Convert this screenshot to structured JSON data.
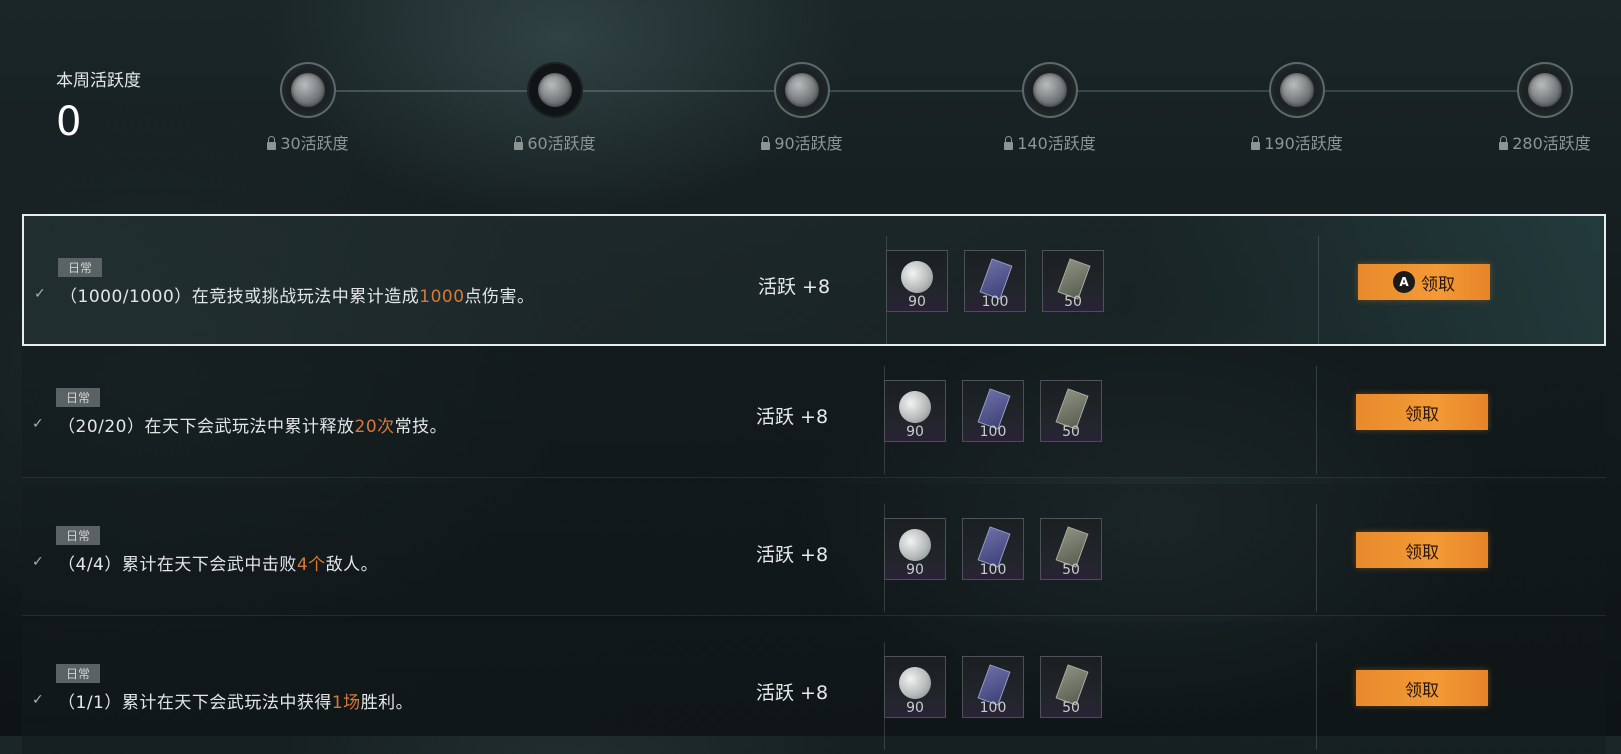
{
  "weekly": {
    "title": "本周活跃度",
    "value": "0"
  },
  "milestones": [
    {
      "label": "30活跃度"
    },
    {
      "label": "60活跃度"
    },
    {
      "label": "90活跃度"
    },
    {
      "label": "140活跃度"
    },
    {
      "label": "190活跃度"
    },
    {
      "label": "280活跃度"
    }
  ],
  "tasks": [
    {
      "badge": "日常",
      "check": "✓",
      "pre": "（1000/1000）在竞技或挑战玩法中累计造成",
      "hl": "1000",
      "post": "点伤害。",
      "activity": "活跃 +8",
      "rewards": [
        "90",
        "100",
        "50"
      ],
      "button_label": "领取",
      "button_prefix": "A"
    },
    {
      "badge": "日常",
      "check": "✓",
      "pre": "（20/20）在天下会武玩法中累计释放",
      "hl": "20次",
      "post": "常技。",
      "activity": "活跃 +8",
      "rewards": [
        "90",
        "100",
        "50"
      ],
      "button_label": "领取"
    },
    {
      "badge": "日常",
      "check": "✓",
      "pre": "（4/4）累计在天下会武中击败",
      "hl": "4个",
      "post": "敌人。",
      "activity": "活跃 +8",
      "rewards": [
        "90",
        "100",
        "50"
      ],
      "button_label": "领取"
    },
    {
      "badge": "日常",
      "check": "✓",
      "pre": "（1/1）累计在天下会武玩法中获得",
      "hl": "1场",
      "post": "胜利。",
      "activity": "活跃 +8",
      "rewards": [
        "90",
        "100",
        "50"
      ],
      "button_label": "领取"
    }
  ],
  "colors": {
    "highlight": "#d9783a",
    "button": "#f39a36"
  }
}
